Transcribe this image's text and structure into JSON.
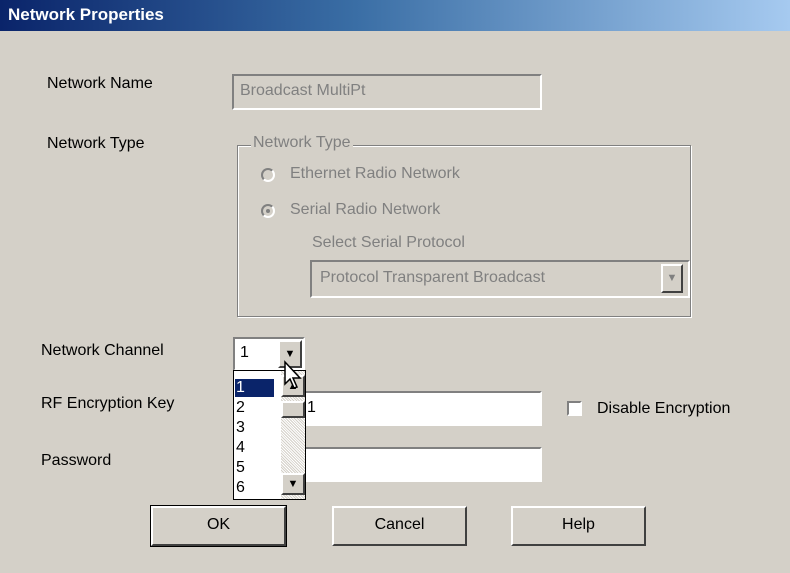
{
  "window": {
    "title": "Network Properties"
  },
  "network_name": {
    "label": "Network Name",
    "value": "Broadcast MultiPt"
  },
  "network_type": {
    "label": "Network Type",
    "group_title": "Network Type",
    "options": [
      {
        "label": "Ethernet Radio Network",
        "selected": false
      },
      {
        "label": "Serial Radio Network",
        "selected": true
      }
    ],
    "protocol_label": "Select Serial Protocol",
    "protocol_value": "Protocol Transparent Broadcast"
  },
  "network_channel": {
    "label": "Network Channel",
    "value": "1",
    "options": [
      "1",
      "2",
      "3",
      "4",
      "5",
      "6"
    ]
  },
  "rf_key": {
    "label": "RF Encryption Key",
    "value": "1"
  },
  "disable_encryption": {
    "label": "Disable Encryption",
    "checked": false
  },
  "password": {
    "label": "Password",
    "value": ""
  },
  "buttons": {
    "ok": "OK",
    "cancel": "Cancel",
    "help": "Help"
  },
  "icons": {
    "dropdown": "chevron-down-icon",
    "scroll_up": "arrow-up-icon",
    "scroll_down": "arrow-down-icon",
    "cursor": "mouse-pointer-icon"
  }
}
